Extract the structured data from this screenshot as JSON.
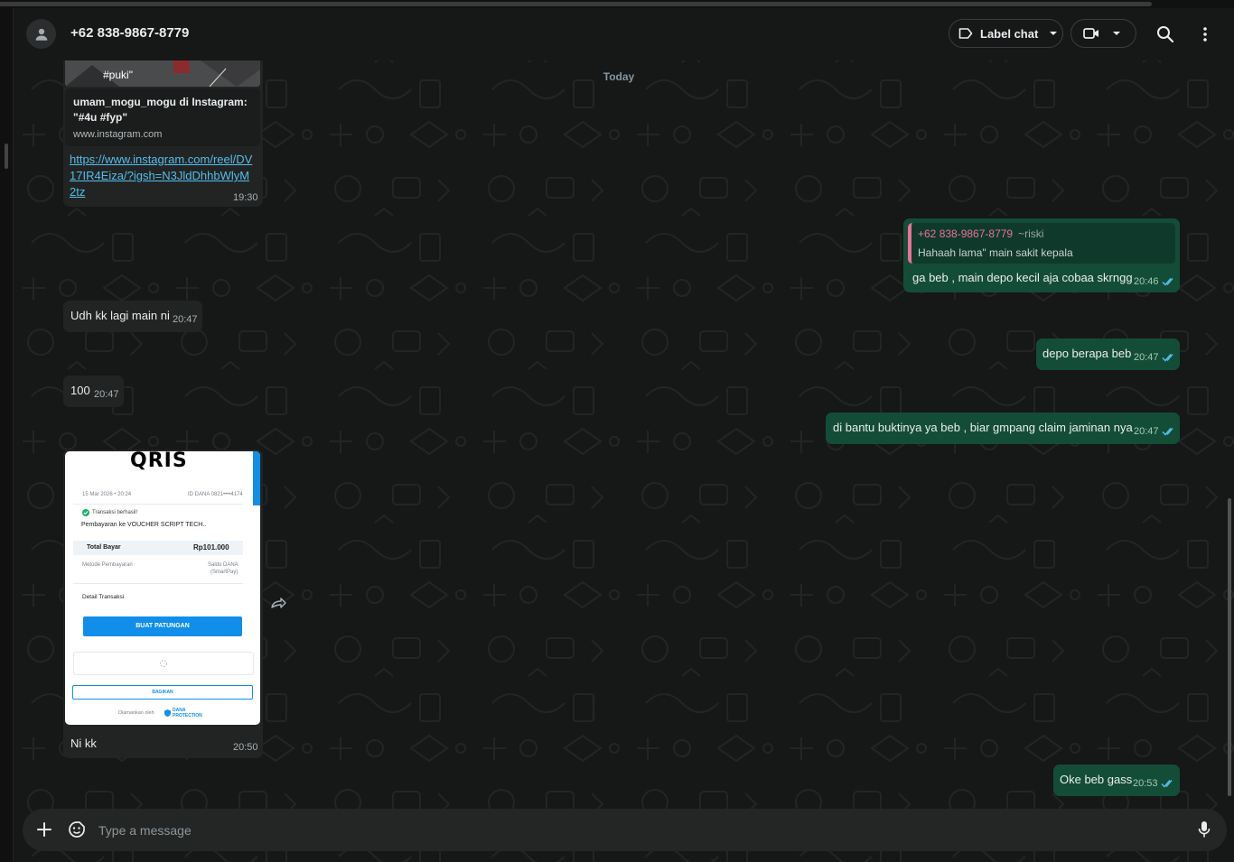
{
  "header": {
    "contact_name": "+62 838-9867-8779",
    "label_chat": "Label chat"
  },
  "date_chip": "Today",
  "messages": [
    {
      "id": "m1",
      "direction": "in",
      "preview_image_text": "#puki\"",
      "preview_title": "umam_mogu_mogu di Instagram: \"#4u #fyp\"",
      "preview_domain": "www.instagram.com",
      "link_text": "https://www.instagram.com/reel/DV17IR4Eiza/?igsh=N3JldDhhbWlyM2tz",
      "time": "19:30"
    },
    {
      "id": "m2",
      "direction": "out",
      "quote_name": "+62 838-9867-8779",
      "quote_alias": "~riski",
      "quote_text": "Hahaah lama\" main sakit kepala",
      "text": "ga beb , main depo kecil aja cobaa skrngg",
      "time": "20:46"
    },
    {
      "id": "m3",
      "direction": "in",
      "text": "Udh kk lagi main ni",
      "time": "20:47"
    },
    {
      "id": "m4",
      "direction": "out",
      "text": "depo berapa beb",
      "time": "20:47"
    },
    {
      "id": "m5",
      "direction": "in",
      "text": "100",
      "time": "20:47"
    },
    {
      "id": "m6",
      "direction": "out",
      "text": "di bantu buktinya ya beb , biar gmpang claim jaminan nya",
      "time": "20:47"
    },
    {
      "id": "m7",
      "direction": "in",
      "caption": "Ni kk",
      "time": "20:50",
      "receipt": {
        "logo": "QRIS",
        "date": "15 Mar 2026 • 20:24",
        "id_text": "ID DANA 0821••••4174",
        "status": "Transaksi berhasil!",
        "merchant": "Pembayaran ke VOUCHER SCRIPT TECH..",
        "total_label": "Total Bayar",
        "total_value": "Rp101.000",
        "method_label": "Metode Pembayaran",
        "method_value_1": "Saldo DANA",
        "method_value_2": "(SmartPay)",
        "detail_label": "Detail Transaksi",
        "button": "BUAT PATUNGAN",
        "share": "BAGIKAN",
        "secured_by": "Diamankan oleh",
        "protection_1": "DANA",
        "protection_2": "PROTECTION"
      }
    },
    {
      "id": "m8",
      "direction": "out",
      "text": "Oke beb gass",
      "time": "20:53"
    }
  ],
  "composer": {
    "placeholder": "Type a message"
  },
  "colors": {
    "incoming_bubble": "#222424",
    "outgoing_bubble": "#144d37",
    "link": "#53bdeb",
    "quote_accent": "#ef7098",
    "read_ticks": "#53bdeb"
  }
}
